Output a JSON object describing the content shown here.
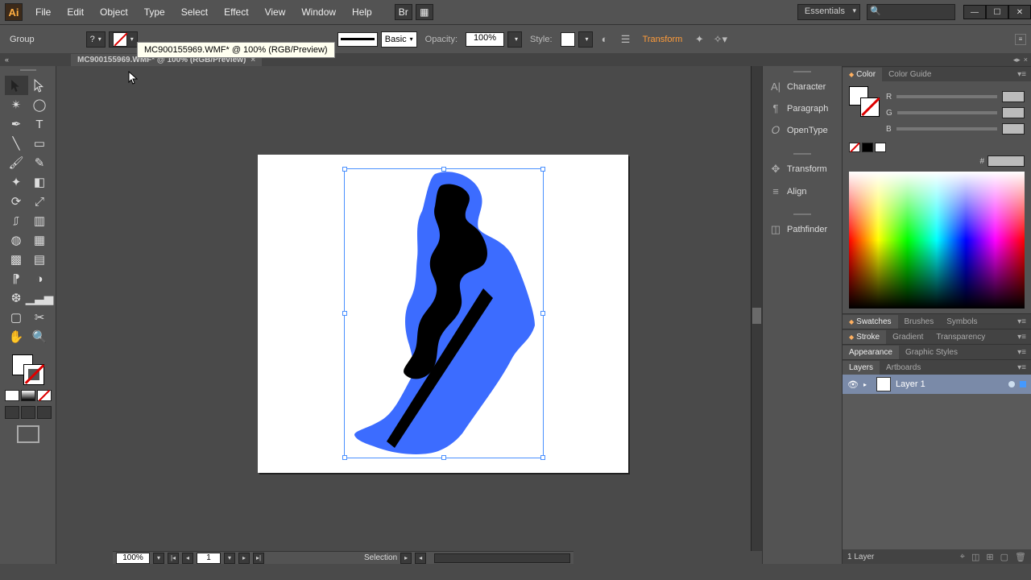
{
  "app": {
    "name": "Ai"
  },
  "menu": [
    "File",
    "Edit",
    "Object",
    "Type",
    "Select",
    "Effect",
    "View",
    "Window",
    "Help"
  ],
  "workspace_name": "Essentials",
  "search_placeholder": "",
  "control_bar": {
    "selection_label": "Group",
    "brush_label": "Basic",
    "opacity_label": "Opacity:",
    "opacity_value": "100%",
    "style_label": "Style:",
    "transform_link": "Transform"
  },
  "tooltip_text": "MC900155969.WMF* @ 100% (RGB/Preview)",
  "document_tab": {
    "title": "MC900155969.WMF* @ 100% (RGB/Preview)"
  },
  "mid_panels": [
    "Character",
    "Paragraph",
    "OpenType",
    "Transform",
    "Align",
    "Pathfinder"
  ],
  "right_dock": {
    "color_tabs": [
      "Color",
      "Color Guide"
    ],
    "channels": [
      "R",
      "G",
      "B"
    ],
    "hex_label": "#",
    "group2_tabs": [
      "Swatches",
      "Brushes",
      "Symbols"
    ],
    "group3_tabs": [
      "Stroke",
      "Gradient",
      "Transparency"
    ],
    "group4_tabs": [
      "Appearance",
      "Graphic Styles"
    ],
    "group5_tabs": [
      "Layers",
      "Artboards"
    ],
    "layers": [
      {
        "name": "Layer 1"
      }
    ],
    "layer_footer": "1 Layer"
  },
  "status": {
    "zoom": "100%",
    "artboard_index": "1",
    "tool": "Selection"
  }
}
